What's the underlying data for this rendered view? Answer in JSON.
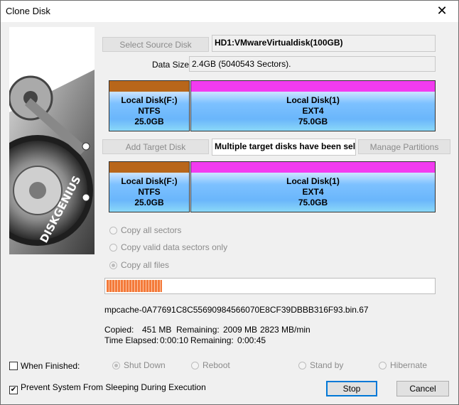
{
  "window": {
    "title": "Clone Disk",
    "close_glyph": "✕"
  },
  "logo": {
    "brand": "DISKGENIUS"
  },
  "source": {
    "select_button": "Select Source Disk",
    "disk_name": "HD1:VMwareVirtualdisk(100GB)",
    "data_size_label": "Data Size:",
    "data_size_value": "2.4GB (5040543 Sectors).",
    "partitions": [
      {
        "name": "Local Disk(F:)",
        "fs": "NTFS",
        "size": "25.0GB",
        "band_color": "#b8661a"
      },
      {
        "name": "Local Disk(1)",
        "fs": "EXT4",
        "size": "75.0GB",
        "band_color": "#f23bf0"
      }
    ]
  },
  "target": {
    "add_button": "Add Target Disk",
    "disk_name": "Multiple target disks have been sele",
    "manage_button": "Manage Partitions",
    "partitions": [
      {
        "name": "Local Disk(F:)",
        "fs": "NTFS",
        "size": "25.0GB",
        "band_color": "#b8661a"
      },
      {
        "name": "Local Disk(1)",
        "fs": "EXT4",
        "size": "75.0GB",
        "band_color": "#f23bf0"
      }
    ]
  },
  "copy_options": [
    {
      "label": "Copy all sectors",
      "selected": false
    },
    {
      "label": "Copy valid data sectors only",
      "selected": false
    },
    {
      "label": "Copy all files",
      "selected": true
    }
  ],
  "progress": {
    "percent": 17,
    "current_file": "mpcache-0A77691C8C55690984566070E8CF39DBBB316F93.bin.67"
  },
  "stats": {
    "copied_label": "Copied:",
    "copied_value": "451 MB",
    "remaining_label": "Remaining:",
    "remaining_value": "2009 MB",
    "speed": "2823 MB/min",
    "elapsed_label": "Time Elapsed:",
    "elapsed_value": "0:00:10",
    "remaining_time_label": "Remaining:",
    "remaining_time_value": "0:00:45"
  },
  "when_finished": {
    "label": "When Finished:",
    "checked": false,
    "options": [
      "Shut Down",
      "Reboot",
      "Stand by",
      "Hibernate"
    ],
    "selected": "Shut Down"
  },
  "prevent_sleep": {
    "label": "Prevent System From Sleeping During Execution",
    "checked": true,
    "check_glyph": "✔"
  },
  "buttons": {
    "stop": "Stop",
    "cancel": "Cancel"
  }
}
